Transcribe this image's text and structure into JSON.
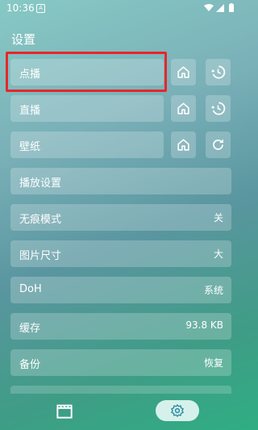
{
  "status_bar": {
    "time": "10:36",
    "notification_letter": "A"
  },
  "page": {
    "title": "设置"
  },
  "rows": {
    "vod": {
      "label": "点播"
    },
    "live": {
      "label": "直播"
    },
    "wallpaper": {
      "label": "壁纸"
    },
    "player_settings": {
      "label": "播放设置"
    },
    "incognito": {
      "label": "无痕模式",
      "value": "关"
    },
    "image_size": {
      "label": "图片尺寸",
      "value": "大"
    },
    "doh": {
      "label": "DoH",
      "value": "系统"
    },
    "cache": {
      "label": "缓存",
      "value": "93.8 KB"
    },
    "backup": {
      "label": "备份",
      "value": "恢复"
    }
  },
  "icons": {
    "home": "home-icon",
    "history": "history-icon",
    "refresh": "refresh-icon",
    "movie": "movie-clapper-icon",
    "settings": "gear-icon"
  },
  "colors": {
    "highlight": "#e8262b",
    "nav_active_bg": "#d6f1eb",
    "nav_active_icon": "#2a8aa0"
  }
}
